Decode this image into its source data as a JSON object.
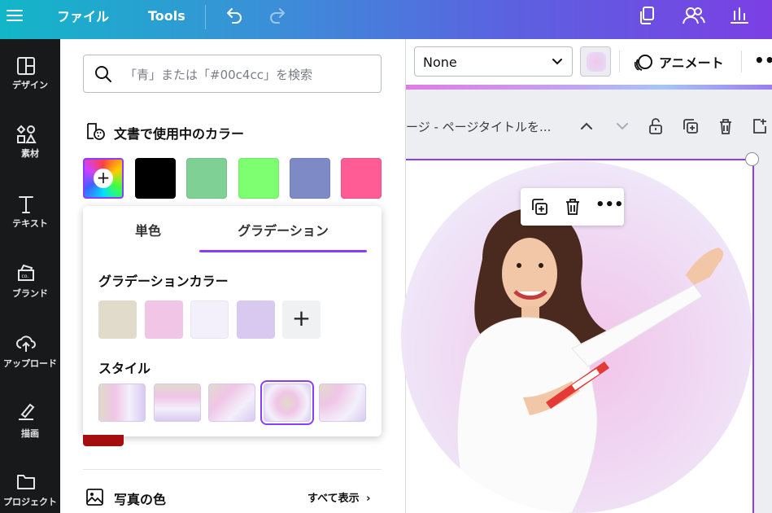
{
  "topbar": {
    "menu_label": "ファイル",
    "tools_label": "Tools"
  },
  "rail": {
    "items": [
      {
        "label": "デザイン",
        "icon": "layout-icon"
      },
      {
        "label": "素材",
        "icon": "shapes-icon"
      },
      {
        "label": "テキスト",
        "icon": "text-icon"
      },
      {
        "label": "ブランド",
        "icon": "brand-icon"
      },
      {
        "label": "アップロード",
        "icon": "upload-icon"
      },
      {
        "label": "描画",
        "icon": "draw-icon"
      },
      {
        "label": "プロジェクト",
        "icon": "folder-icon"
      }
    ]
  },
  "panel": {
    "search_placeholder": "「青」または「#00c4cc」を検索",
    "doc_colors_title": "文書で使用中のカラー",
    "doc_colors": [
      "#000000",
      "#7fd094",
      "#7dff71",
      "#7d8ac6",
      "#ff5c96"
    ],
    "tabs": {
      "solid": "単色",
      "gradient": "グラデーション"
    },
    "gradient_colors_title": "グラデーションカラー",
    "gradient_colors": [
      "#e0dbca",
      "#f0c5e6",
      "#f3f0fb",
      "#d9c9f1"
    ],
    "style_title": "スタイル",
    "photo_colors_title": "写真の色",
    "see_all": "すべて表示"
  },
  "editor": {
    "font_value": "None",
    "animate_label": "アニメート",
    "page_title": "ージ - ページタイトルを..."
  },
  "colors": {
    "accent": "#8b3dff"
  }
}
